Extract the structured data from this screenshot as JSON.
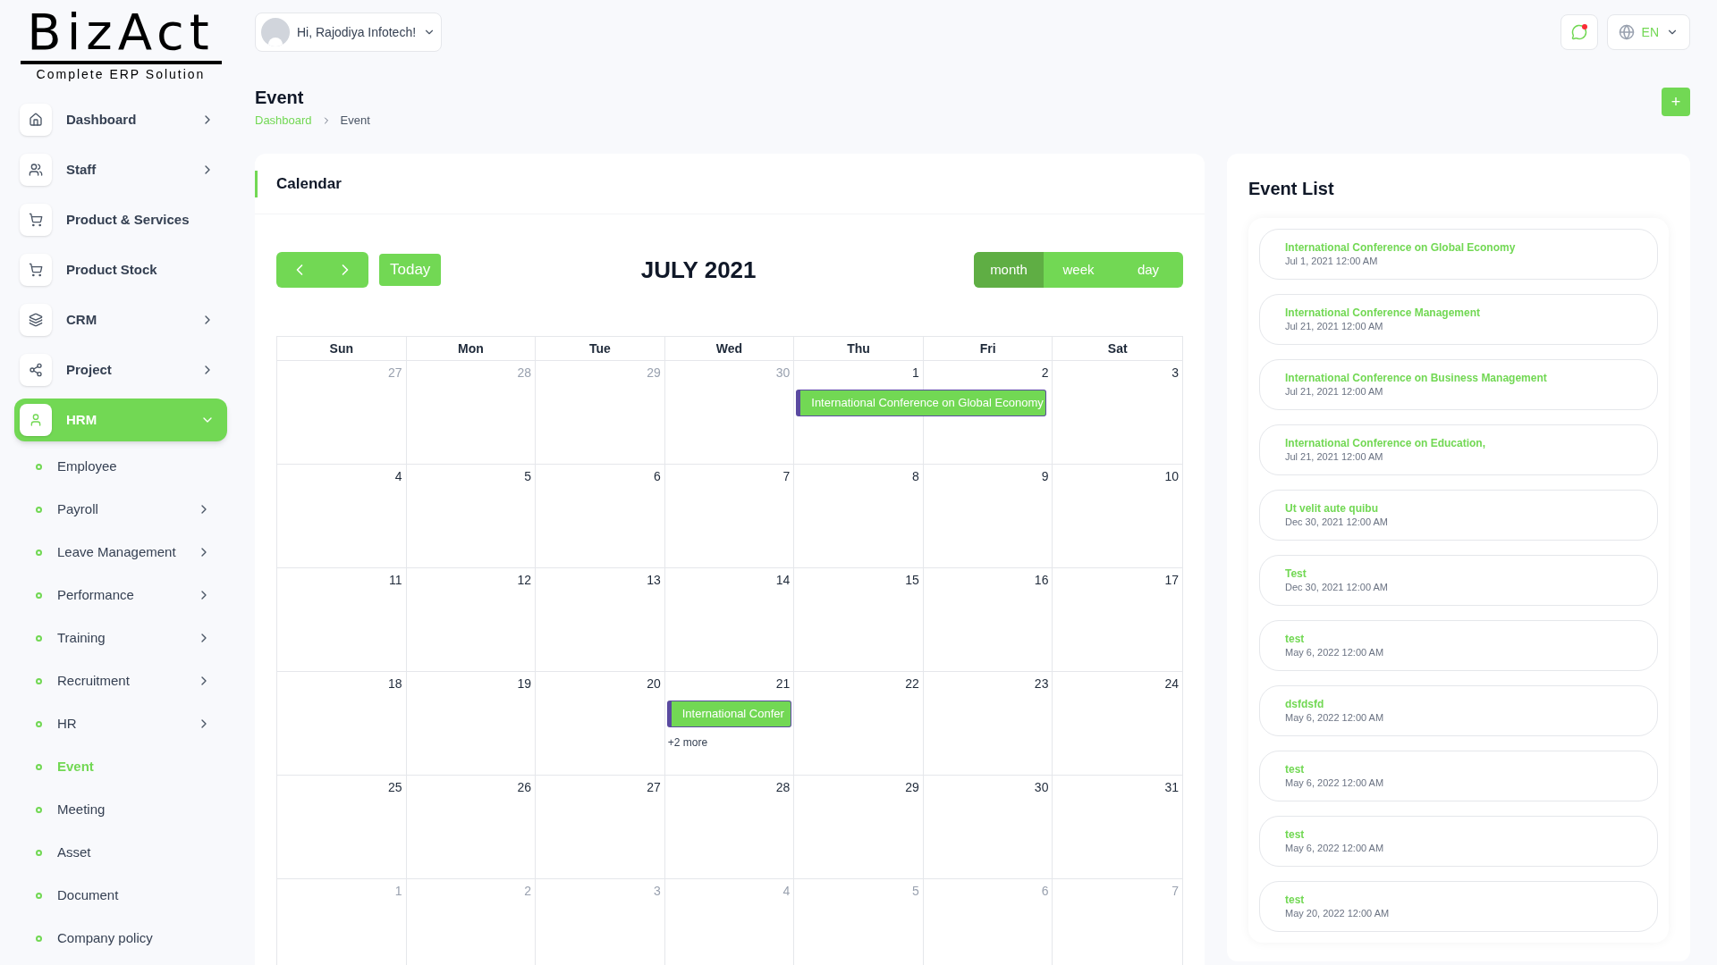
{
  "logo": {
    "name": "BizAct",
    "tagline": "Complete ERP Solution"
  },
  "sidebar": {
    "items": [
      {
        "label": "Dashboard",
        "has_arrow": true,
        "expanded": false,
        "selected": false
      },
      {
        "label": "Staff",
        "has_arrow": true,
        "expanded": false,
        "selected": false
      },
      {
        "label": "Product & Services",
        "has_arrow": false,
        "expanded": false,
        "selected": false
      },
      {
        "label": "Product Stock",
        "has_arrow": false,
        "expanded": false,
        "selected": false
      },
      {
        "label": "CRM",
        "has_arrow": true,
        "expanded": false,
        "selected": false
      },
      {
        "label": "Project",
        "has_arrow": true,
        "expanded": false,
        "selected": false
      },
      {
        "label": "HRM",
        "has_arrow": true,
        "expanded": true,
        "selected": true,
        "children": [
          {
            "label": "Employee",
            "has_arrow": false,
            "selected": false
          },
          {
            "label": "Payroll",
            "has_arrow": true,
            "selected": false
          },
          {
            "label": "Leave Management",
            "has_arrow": true,
            "selected": false
          },
          {
            "label": "Performance",
            "has_arrow": true,
            "selected": false
          },
          {
            "label": "Training",
            "has_arrow": true,
            "selected": false
          },
          {
            "label": "Recruitment",
            "has_arrow": true,
            "selected": false
          },
          {
            "label": "HR",
            "has_arrow": true,
            "selected": false
          },
          {
            "label": "Event",
            "has_arrow": false,
            "selected": true
          },
          {
            "label": "Meeting",
            "has_arrow": false,
            "selected": false
          },
          {
            "label": "Asset",
            "has_arrow": false,
            "selected": false
          },
          {
            "label": "Document",
            "has_arrow": false,
            "selected": false
          },
          {
            "label": "Company policy",
            "has_arrow": false,
            "selected": false
          }
        ]
      }
    ]
  },
  "header": {
    "greeting": "Hi, Rajodiya Infotech!",
    "language": "EN",
    "has_notification": true
  },
  "page": {
    "title": "Event",
    "breadcrumb": [
      "Dashboard",
      "Event"
    ],
    "add_button": "+"
  },
  "calendar": {
    "title": "Calendar",
    "month": "JULY 2021",
    "today": "Today",
    "views": [
      {
        "label": "month",
        "selected": true
      },
      {
        "label": "week",
        "selected": false
      },
      {
        "label": "day",
        "selected": false
      }
    ],
    "weekdays": [
      "Sun",
      "Mon",
      "Tue",
      "Wed",
      "Thu",
      "Fri",
      "Sat"
    ],
    "weeks": [
      [
        {
          "day": "27",
          "muted": true
        },
        {
          "day": "28",
          "muted": true
        },
        {
          "day": "29",
          "muted": true
        },
        {
          "day": "30",
          "muted": true
        },
        {
          "day": "1",
          "muted": false,
          "events": [
            {
              "title": "International Conference on Global Economy",
              "continues": true
            }
          ]
        },
        {
          "day": "2",
          "muted": false
        },
        {
          "day": "3",
          "muted": false
        }
      ],
      [
        {
          "day": "4",
          "muted": false
        },
        {
          "day": "5",
          "muted": false
        },
        {
          "day": "6",
          "muted": false
        },
        {
          "day": "7",
          "muted": false
        },
        {
          "day": "8",
          "muted": false
        },
        {
          "day": "9",
          "muted": false
        },
        {
          "day": "10",
          "muted": false
        }
      ],
      [
        {
          "day": "11",
          "muted": false
        },
        {
          "day": "12",
          "muted": false
        },
        {
          "day": "13",
          "muted": false
        },
        {
          "day": "14",
          "muted": false
        },
        {
          "day": "15",
          "muted": false
        },
        {
          "day": "16",
          "muted": false
        },
        {
          "day": "17",
          "muted": false
        }
      ],
      [
        {
          "day": "18",
          "muted": false
        },
        {
          "day": "19",
          "muted": false
        },
        {
          "day": "20",
          "muted": false
        },
        {
          "day": "21",
          "muted": false,
          "events": [
            {
              "title": "International Confer",
              "continues": false
            }
          ],
          "more": "+2 more"
        },
        {
          "day": "22",
          "muted": false
        },
        {
          "day": "23",
          "muted": false
        },
        {
          "day": "24",
          "muted": false
        }
      ],
      [
        {
          "day": "25",
          "muted": false
        },
        {
          "day": "26",
          "muted": false
        },
        {
          "day": "27",
          "muted": false
        },
        {
          "day": "28",
          "muted": false
        },
        {
          "day": "29",
          "muted": false
        },
        {
          "day": "30",
          "muted": false
        },
        {
          "day": "31",
          "muted": false
        }
      ],
      [
        {
          "day": "1",
          "muted": true
        },
        {
          "day": "2",
          "muted": true
        },
        {
          "day": "3",
          "muted": true
        },
        {
          "day": "4",
          "muted": true
        },
        {
          "day": "5",
          "muted": true
        },
        {
          "day": "6",
          "muted": true
        },
        {
          "day": "7",
          "muted": true
        }
      ]
    ]
  },
  "event_list": {
    "title": "Event List",
    "items": [
      {
        "title": "International Conference on Global Economy",
        "date": "Jul 1, 2021 12:00 AM"
      },
      {
        "title": "International Conference Management",
        "date": "Jul 21, 2021 12:00 AM"
      },
      {
        "title": "International Conference on Business Management",
        "date": "Jul 21, 2021 12:00 AM"
      },
      {
        "title": "International Conference on Education,",
        "date": "Jul 21, 2021 12:00 AM"
      },
      {
        "title": "Ut velit aute quibu",
        "date": "Dec 30, 2021 12:00 AM"
      },
      {
        "title": "Test",
        "date": "Dec 30, 2021 12:00 AM"
      },
      {
        "title": "test",
        "date": "May 6, 2022 12:00 AM"
      },
      {
        "title": "dsfdsfd",
        "date": "May 6, 2022 12:00 AM"
      },
      {
        "title": "test",
        "date": "May 6, 2022 12:00 AM"
      },
      {
        "title": "test",
        "date": "May 6, 2022 12:00 AM"
      },
      {
        "title": "test",
        "date": "May 20, 2022 12:00 AM"
      }
    ]
  }
}
